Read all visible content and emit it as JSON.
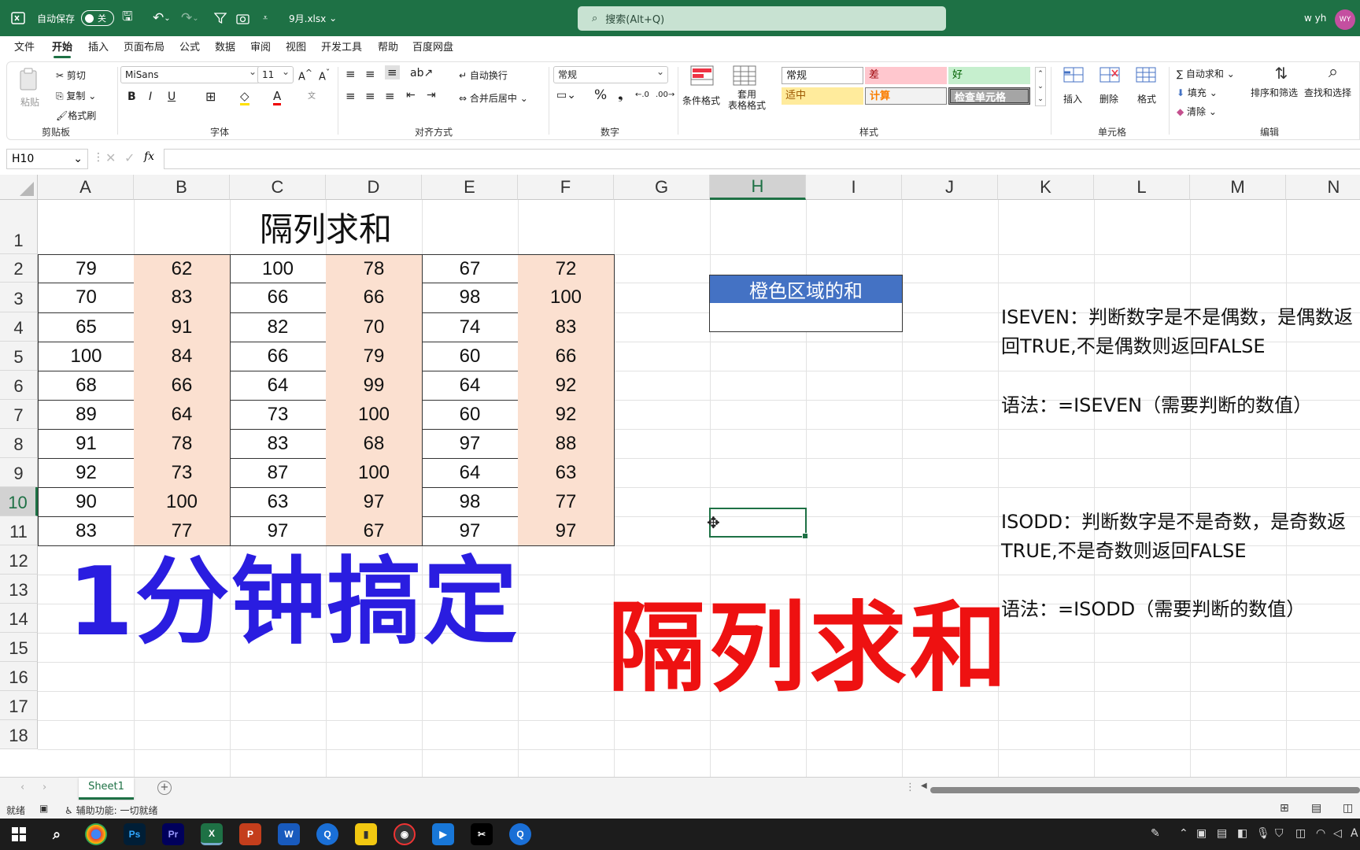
{
  "titlebar": {
    "autosave_label": "自动保存",
    "autosave_state": "关",
    "filename": "9月.xlsx",
    "search_placeholder": "搜索(Alt+Q)",
    "user_name": "w yh",
    "avatar_initials": "WY"
  },
  "menu": {
    "items": [
      "文件",
      "开始",
      "插入",
      "页面布局",
      "公式",
      "数据",
      "审阅",
      "视图",
      "开发工具",
      "帮助",
      "百度网盘"
    ],
    "active": "开始"
  },
  "ribbon": {
    "clipboard": {
      "paste": "粘贴",
      "cut": "剪切",
      "copy": "复制",
      "format_painter": "格式刷",
      "label": "剪贴板"
    },
    "font": {
      "name": "MiSans",
      "size": "11",
      "label": "字体",
      "bold": "B",
      "italic": "I",
      "underline": "U"
    },
    "alignment": {
      "wrap": "自动换行",
      "merge": "合并后居中",
      "label": "对齐方式"
    },
    "number": {
      "format": "常规",
      "label": "数字",
      "percent": "%"
    },
    "styles": {
      "conditional": "条件格式",
      "table_format": "套用\n表格格式",
      "normal": "常规",
      "bad": "差",
      "good": "好",
      "neutral": "适中",
      "calc": "计算",
      "check": "检查单元格",
      "label": "样式"
    },
    "cells": {
      "insert": "插入",
      "delete": "删除",
      "format": "格式",
      "label": "单元格"
    },
    "editing": {
      "autosum": "自动求和",
      "fill": "填充",
      "clear": "清除",
      "sort": "排序和筛选",
      "find": "查找和选择",
      "label": "编辑"
    }
  },
  "formula_bar": {
    "name_box": "H10",
    "fx": "fx",
    "formula": ""
  },
  "columns": [
    "A",
    "B",
    "C",
    "D",
    "E",
    "F",
    "G",
    "H",
    "I",
    "J",
    "K",
    "L",
    "M",
    "N"
  ],
  "rows": [
    "1",
    "2",
    "3",
    "4",
    "5",
    "6",
    "7",
    "8",
    "9",
    "10",
    "11",
    "12",
    "13",
    "14",
    "15",
    "16",
    "17",
    "18"
  ],
  "sheet": {
    "title": "隔列求和",
    "table": [
      [
        79,
        62,
        100,
        78,
        67,
        72
      ],
      [
        70,
        83,
        66,
        66,
        98,
        100
      ],
      [
        65,
        91,
        82,
        70,
        74,
        83
      ],
      [
        100,
        84,
        66,
        79,
        60,
        66
      ],
      [
        68,
        66,
        64,
        99,
        64,
        92
      ],
      [
        89,
        64,
        73,
        100,
        60,
        92
      ],
      [
        91,
        78,
        83,
        68,
        97,
        88
      ],
      [
        92,
        73,
        87,
        100,
        64,
        63
      ],
      [
        90,
        100,
        63,
        97,
        98,
        77
      ],
      [
        83,
        77,
        97,
        67,
        97,
        97
      ]
    ],
    "orange_header": "橙色区域的和",
    "orange_sum": "",
    "notes": {
      "iseven_1": "ISEVEN：判断数字是不是偶数，是偶数返",
      "iseven_2": "回TRUE,不是偶数则返回FALSE",
      "iseven_syntax": "语法：=ISEVEN（需要判断的数值）",
      "isodd_1": "ISODD：判断数字是不是奇数，是奇数返",
      "isodd_2": "TRUE,不是奇数则返回FALSE",
      "isodd_syntax": "语法：=ISODD（需要判断的数值）"
    },
    "overlay_blue": "1分钟搞定",
    "overlay_red": "隔列求和"
  },
  "colors": {
    "excel_green": "#1e7145",
    "orange_fill": "#fbe0d0",
    "header_blue": "#4472c4",
    "overlay_blue": "#2a1de0",
    "overlay_red": "#ee1111"
  },
  "sheet_tabs": [
    "Sheet1"
  ],
  "status": {
    "ready": "就绪",
    "accessibility": "辅助功能: 一切就绪"
  }
}
